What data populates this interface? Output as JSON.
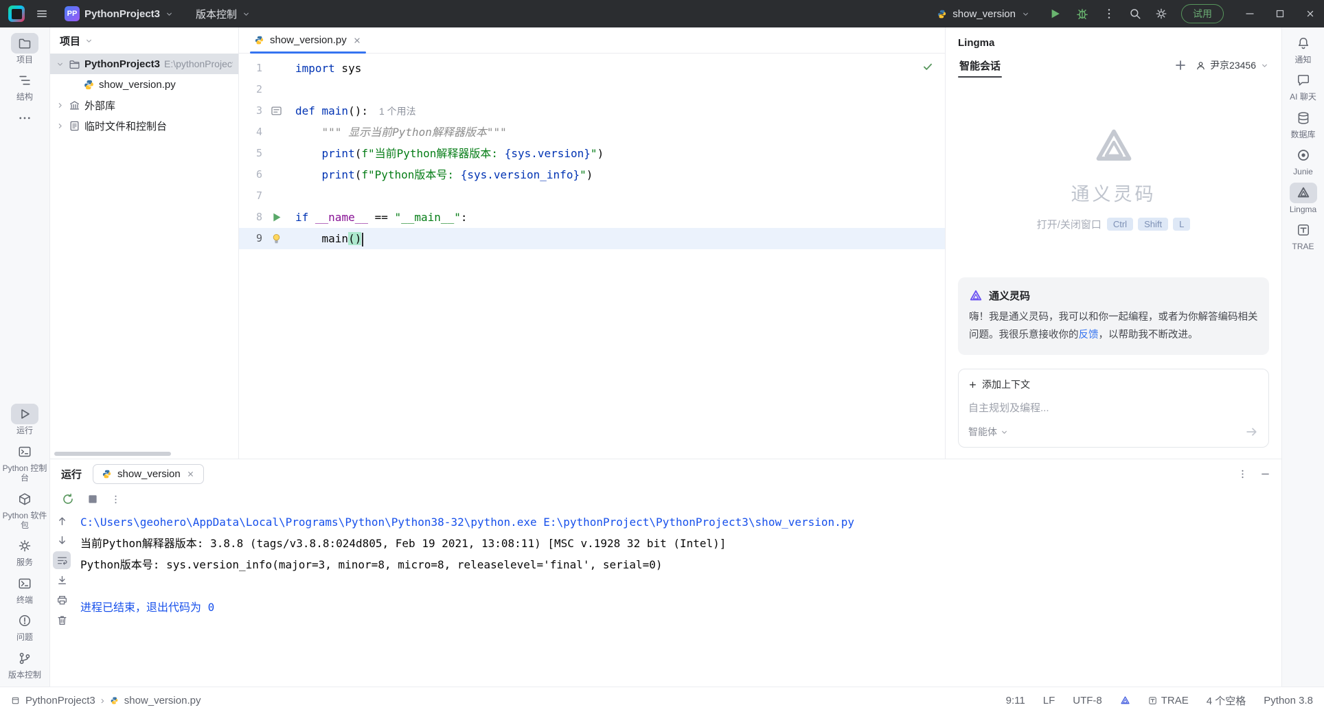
{
  "titlebar": {
    "logo_text": "PP",
    "project_name": "PythonProject3",
    "vcs_label": "版本控制",
    "run_config": "show_version",
    "trial_label": "试用"
  },
  "left_strip": {
    "top": [
      {
        "label": "项目",
        "icon": "folder",
        "selected": true
      },
      {
        "label": "结构",
        "icon": "structure",
        "selected": false
      },
      {
        "label": "",
        "icon": "more",
        "selected": false
      }
    ],
    "bottom": [
      {
        "label": "运行",
        "icon": "play",
        "selected": true
      },
      {
        "label": "Python 控制台",
        "icon": "pyconsole",
        "selected": false
      },
      {
        "label": "Python 软件包",
        "icon": "package",
        "selected": false
      },
      {
        "label": "服务",
        "icon": "services",
        "selected": false
      },
      {
        "label": "终端",
        "icon": "terminal",
        "selected": false
      },
      {
        "label": "问题",
        "icon": "problems",
        "selected": false
      },
      {
        "label": "版本控制",
        "icon": "vcs",
        "selected": false
      }
    ]
  },
  "right_strip": {
    "items": [
      {
        "label": "通知",
        "icon": "bell",
        "selected": false
      },
      {
        "label": "AI 聊天",
        "icon": "chat",
        "selected": false
      },
      {
        "label": "数据库",
        "icon": "db",
        "selected": false
      },
      {
        "label": "Junie",
        "icon": "junie",
        "selected": false
      },
      {
        "label": "Lingma",
        "icon": "lingma",
        "selected": true
      },
      {
        "label": "TRAE",
        "icon": "trae",
        "selected": false
      }
    ]
  },
  "project": {
    "header": "项目",
    "root_name": "PythonProject3",
    "root_path": "E:\\pythonProject\\P",
    "file_name": "show_version.py",
    "external_libs": "外部库",
    "scratches": "临时文件和控制台"
  },
  "editor": {
    "tab_label": "show_version.py",
    "code_lines": [
      {
        "no": "1",
        "segs": [
          {
            "t": "import",
            "c": "kw"
          },
          {
            "t": " sys",
            "c": "pl"
          }
        ]
      },
      {
        "no": "2",
        "segs": []
      },
      {
        "no": "3",
        "gutter": "usage",
        "segs": [
          {
            "t": "def ",
            "c": "kw"
          },
          {
            "t": "main",
            "c": "fn"
          },
          {
            "t": "():",
            "c": "pl"
          },
          {
            "t": "1 个用法",
            "c": "hint"
          }
        ]
      },
      {
        "no": "4",
        "segs": [
          {
            "t": "    ",
            "c": "pl"
          },
          {
            "t": "\"\"\" 显示当前Python解释器版本\"\"\"",
            "c": "doc"
          }
        ]
      },
      {
        "no": "5",
        "segs": [
          {
            "t": "    ",
            "c": "pl"
          },
          {
            "t": "print",
            "c": "kw"
          },
          {
            "t": "(",
            "c": "pl"
          },
          {
            "t": "f\"当前Python解释器版本: ",
            "c": "str"
          },
          {
            "t": "{sys.version}",
            "c": "interp"
          },
          {
            "t": "\"",
            "c": "str"
          },
          {
            "t": ")",
            "c": "pl"
          }
        ]
      },
      {
        "no": "6",
        "segs": [
          {
            "t": "    ",
            "c": "pl"
          },
          {
            "t": "print",
            "c": "kw"
          },
          {
            "t": "(",
            "c": "pl"
          },
          {
            "t": "f\"Python版本号: ",
            "c": "str"
          },
          {
            "t": "{sys.version_info}",
            "c": "interp"
          },
          {
            "t": "\"",
            "c": "str"
          },
          {
            "t": ")",
            "c": "pl"
          }
        ]
      },
      {
        "no": "7",
        "segs": []
      },
      {
        "no": "8",
        "gutter": "run",
        "segs": [
          {
            "t": "if ",
            "c": "kw"
          },
          {
            "t": "__name__",
            "c": "dunder"
          },
          {
            "t": " == ",
            "c": "pl"
          },
          {
            "t": "\"__main__\"",
            "c": "str"
          },
          {
            "t": ":",
            "c": "pl"
          }
        ]
      },
      {
        "no": "9",
        "gutter": "bulb",
        "current": true,
        "segs": [
          {
            "t": "    ",
            "c": "pl"
          },
          {
            "t": "main",
            "c": "pl"
          },
          {
            "t": "()",
            "c": "hl"
          }
        ]
      }
    ]
  },
  "lingma": {
    "title": "Lingma",
    "tab": "智能会话",
    "user": "尹京23456",
    "hero_title": "通义灵码",
    "shortcut_label": "打开/关闭窗口",
    "shortcut_keys": [
      "Ctrl",
      "Shift",
      "L"
    ],
    "card": {
      "title": "通义灵码",
      "text_before": "嗨！我是通义灵码，我可以和你一起编程，或者为你解答编码相关问题。我很乐意接收你的",
      "link": "反馈",
      "text_after": "，以帮助我不断改进。"
    },
    "add_context": "添加上下文",
    "input_placeholder": "自主规划及编程...",
    "agent_label": "智能体"
  },
  "run_panel": {
    "title": "运行",
    "tab": "show_version",
    "console_strip": [
      {
        "icon": "up",
        "selected": false
      },
      {
        "icon": "down",
        "selected": false
      },
      {
        "icon": "softwrap",
        "selected": true
      },
      {
        "icon": "scrollend",
        "selected": false
      },
      {
        "icon": "print",
        "selected": false
      },
      {
        "icon": "trash",
        "selected": false
      }
    ],
    "console_lines": [
      {
        "t": "C:\\Users\\geohero\\AppData\\Local\\Programs\\Python\\Python38-32\\python.exe E:\\pythonProject\\PythonProject3\\show_version.py",
        "c": "cmd"
      },
      {
        "t": "当前Python解释器版本: 3.8.8 (tags/v3.8.8:024d805, Feb 19 2021, 13:08:11) [MSC v.1928 32 bit (Intel)]",
        "c": "out"
      },
      {
        "t": "Python版本号: sys.version_info(major=3, minor=8, micro=8, releaselevel='final', serial=0)",
        "c": "out"
      },
      {
        "t": "",
        "c": "out"
      },
      {
        "t": "进程已结束，退出代码为 0",
        "c": "sys"
      }
    ]
  },
  "statusbar": {
    "breadcrumb": [
      "PythonProject3",
      "show_version.py"
    ],
    "caret": "9:11",
    "line_sep": "LF",
    "encoding": "UTF-8",
    "trae": "TRAE",
    "indent": "4 个空格",
    "interpreter": "Python 3.8"
  },
  "colors": {
    "accent_blue": "#3574F0",
    "run_green": "#59A869",
    "keyword_blue": "#0033B3",
    "string_green": "#067D17",
    "console_command_blue": "#1750EB",
    "titlebar_bg": "#2B2D30",
    "brace_match_teal": "#ADE8CE",
    "lingma_purple": "#6C53F2"
  }
}
